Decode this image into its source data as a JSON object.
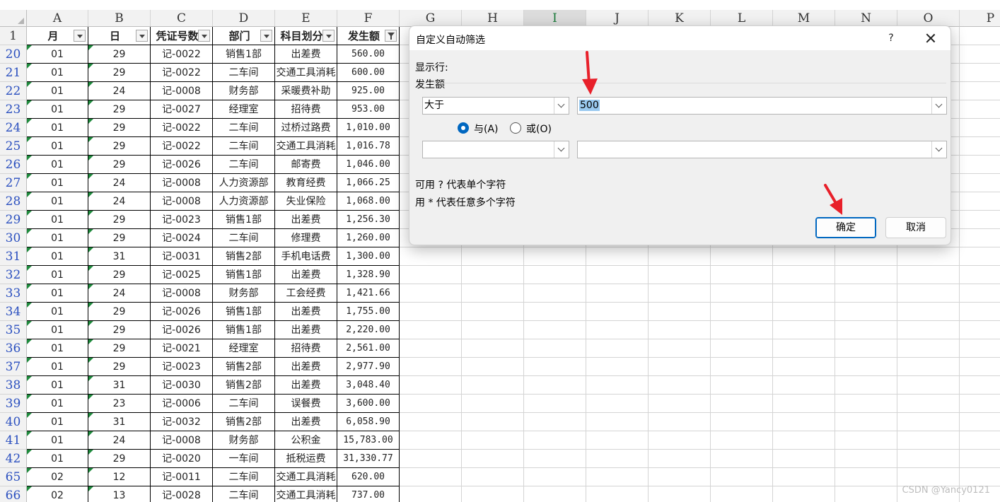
{
  "columns": [
    "A",
    "B",
    "C",
    "D",
    "E",
    "F",
    "G",
    "H",
    "I",
    "J",
    "K",
    "L",
    "M",
    "N",
    "O",
    "P"
  ],
  "header_row": {
    "number": "1",
    "cells": [
      "月",
      "日",
      "凭证号数",
      "部门",
      "科目划分",
      "发生额"
    ]
  },
  "rows": [
    {
      "num": "20",
      "cells": [
        "01",
        "29",
        "记-0022",
        "销售1部",
        "出差费",
        "560.00"
      ]
    },
    {
      "num": "21",
      "cells": [
        "01",
        "29",
        "记-0022",
        "二车间",
        "交通工具消耗",
        "600.00"
      ]
    },
    {
      "num": "22",
      "cells": [
        "01",
        "24",
        "记-0008",
        "财务部",
        "采暖费补助",
        "925.00"
      ]
    },
    {
      "num": "23",
      "cells": [
        "01",
        "29",
        "记-0027",
        "经理室",
        "招待费",
        "953.00"
      ]
    },
    {
      "num": "24",
      "cells": [
        "01",
        "29",
        "记-0022",
        "二车间",
        "过桥过路费",
        "1,010.00"
      ]
    },
    {
      "num": "25",
      "cells": [
        "01",
        "29",
        "记-0022",
        "二车间",
        "交通工具消耗",
        "1,016.78"
      ]
    },
    {
      "num": "26",
      "cells": [
        "01",
        "29",
        "记-0026",
        "二车间",
        "邮寄费",
        "1,046.00"
      ]
    },
    {
      "num": "27",
      "cells": [
        "01",
        "24",
        "记-0008",
        "人力资源部",
        "教育经费",
        "1,066.25"
      ]
    },
    {
      "num": "28",
      "cells": [
        "01",
        "24",
        "记-0008",
        "人力资源部",
        "失业保险",
        "1,068.00"
      ]
    },
    {
      "num": "29",
      "cells": [
        "01",
        "29",
        "记-0023",
        "销售1部",
        "出差费",
        "1,256.30"
      ]
    },
    {
      "num": "30",
      "cells": [
        "01",
        "29",
        "记-0024",
        "二车间",
        "修理费",
        "1,260.00"
      ]
    },
    {
      "num": "31",
      "cells": [
        "01",
        "31",
        "记-0031",
        "销售2部",
        "手机电话费",
        "1,300.00"
      ]
    },
    {
      "num": "32",
      "cells": [
        "01",
        "29",
        "记-0025",
        "销售1部",
        "出差费",
        "1,328.90"
      ]
    },
    {
      "num": "33",
      "cells": [
        "01",
        "24",
        "记-0008",
        "财务部",
        "工会经费",
        "1,421.66"
      ]
    },
    {
      "num": "34",
      "cells": [
        "01",
        "29",
        "记-0026",
        "销售1部",
        "出差费",
        "1,755.00"
      ]
    },
    {
      "num": "35",
      "cells": [
        "01",
        "29",
        "记-0026",
        "销售1部",
        "出差费",
        "2,220.00"
      ]
    },
    {
      "num": "36",
      "cells": [
        "01",
        "29",
        "记-0021",
        "经理室",
        "招待费",
        "2,561.00"
      ]
    },
    {
      "num": "37",
      "cells": [
        "01",
        "29",
        "记-0023",
        "销售2部",
        "出差费",
        "2,977.90"
      ]
    },
    {
      "num": "38",
      "cells": [
        "01",
        "31",
        "记-0030",
        "销售2部",
        "出差费",
        "3,048.40"
      ]
    },
    {
      "num": "39",
      "cells": [
        "01",
        "23",
        "记-0006",
        "二车间",
        "误餐费",
        "3,600.00"
      ]
    },
    {
      "num": "40",
      "cells": [
        "01",
        "31",
        "记-0032",
        "销售2部",
        "出差费",
        "6,058.90"
      ]
    },
    {
      "num": "41",
      "cells": [
        "01",
        "24",
        "记-0008",
        "财务部",
        "公积金",
        "15,783.00"
      ]
    },
    {
      "num": "42",
      "cells": [
        "01",
        "29",
        "记-0020",
        "一车间",
        "抵税运费",
        "31,330.77"
      ]
    },
    {
      "num": "65",
      "cells": [
        "02",
        "12",
        "记-0011",
        "二车间",
        "交通工具消耗",
        "620.00"
      ]
    },
    {
      "num": "66",
      "cells": [
        "02",
        "13",
        "记-0028",
        "二车间",
        "交通工具消耗",
        "737.00"
      ]
    }
  ],
  "dialog": {
    "title": "自定义自动筛选",
    "help": "?",
    "show_rows_label": "显示行:",
    "field_label": "发生额",
    "condition1": {
      "operator": "大于",
      "value": "500"
    },
    "and_label": "与(A)",
    "or_label": "或(O)",
    "logic_selected": "and",
    "condition2": {
      "operator": "",
      "value": ""
    },
    "hint1": "可用 ? 代表单个字符",
    "hint2": "用 * 代表任意多个字符",
    "ok_label": "确定",
    "cancel_label": "取消"
  },
  "watermark": "CSDN @Yancy0121",
  "colors": {
    "annotation_arrow": "#e8202a",
    "accent": "#0067c0",
    "row_number": "#2a4fbf"
  }
}
